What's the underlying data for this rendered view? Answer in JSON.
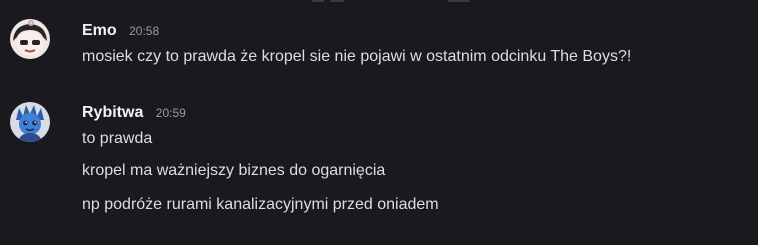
{
  "channel": {
    "messages": [
      {
        "author": "Emo",
        "time": "20:58",
        "avatar": "emo-avatar-icon",
        "lines": [
          "mosiek czy to prawda że kropel sie nie pojawi w ostatnim odcinku The Boys?!"
        ]
      },
      {
        "author": "Rybitwa",
        "time": "20:59",
        "avatar": "rybitwa-avatar-icon",
        "lines": [
          "to prawda",
          "kropel ma ważniejszy biznes do ogarnięcia",
          "np podróże rurami kanalizacyjnymi przed oniadem"
        ]
      }
    ]
  },
  "colors": {
    "background": "#1a1a1e",
    "username": "#f2f3f5",
    "timestamp": "#949ba4",
    "message_text": "#dbdee1"
  }
}
